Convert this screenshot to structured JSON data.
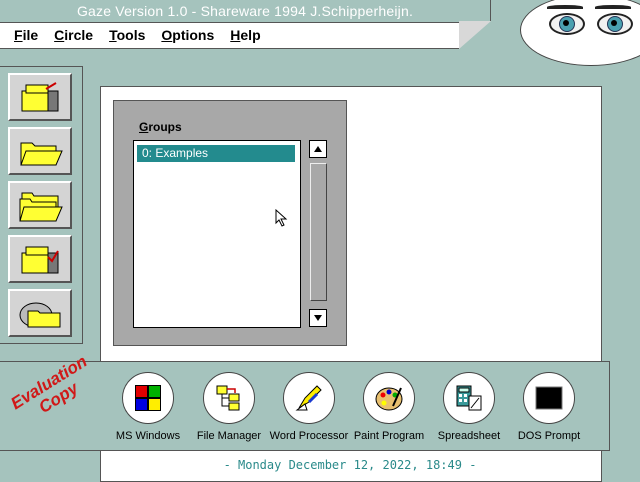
{
  "window": {
    "title": "Gaze Version 1.0 - Shareware 1994 J.Schipperheijn."
  },
  "menu": {
    "items": [
      {
        "key": "F",
        "rest": "ile"
      },
      {
        "key": "C",
        "rest": "ircle"
      },
      {
        "key": "T",
        "rest": "ools"
      },
      {
        "key": "O",
        "rest": "ptions"
      },
      {
        "key": "H",
        "rest": "elp"
      }
    ]
  },
  "toolbar": {
    "buttons": [
      {
        "icon": "file-cabinet-open-icon"
      },
      {
        "icon": "folder-open-icon"
      },
      {
        "icon": "folders-icon"
      },
      {
        "icon": "file-cabinet-check-icon"
      },
      {
        "icon": "disk-folder-icon"
      }
    ]
  },
  "groups": {
    "label_key": "G",
    "label_rest": "roups",
    "items": [
      "0: Examples"
    ],
    "selected": 0
  },
  "badge": {
    "line1": "Evaluation",
    "line2": "Copy",
    "color": "#d01818"
  },
  "apps": [
    {
      "label": "MS Windows",
      "icon": "windows-logo-icon"
    },
    {
      "label": "File Manager",
      "icon": "file-manager-icon"
    },
    {
      "label": "Word Processor",
      "icon": "pen-nib-icon"
    },
    {
      "label": "Paint Program",
      "icon": "palette-icon"
    },
    {
      "label": "Spreadsheet",
      "icon": "calculator-icon"
    },
    {
      "label": "DOS Prompt",
      "icon": "dos-screen-icon"
    }
  ],
  "status": {
    "datetime": "- Monday December 12, 2022, 18:49 -"
  },
  "colors": {
    "background": "#a5c3bd",
    "selection": "#238b8e",
    "datetime": "#2a8a8a"
  }
}
